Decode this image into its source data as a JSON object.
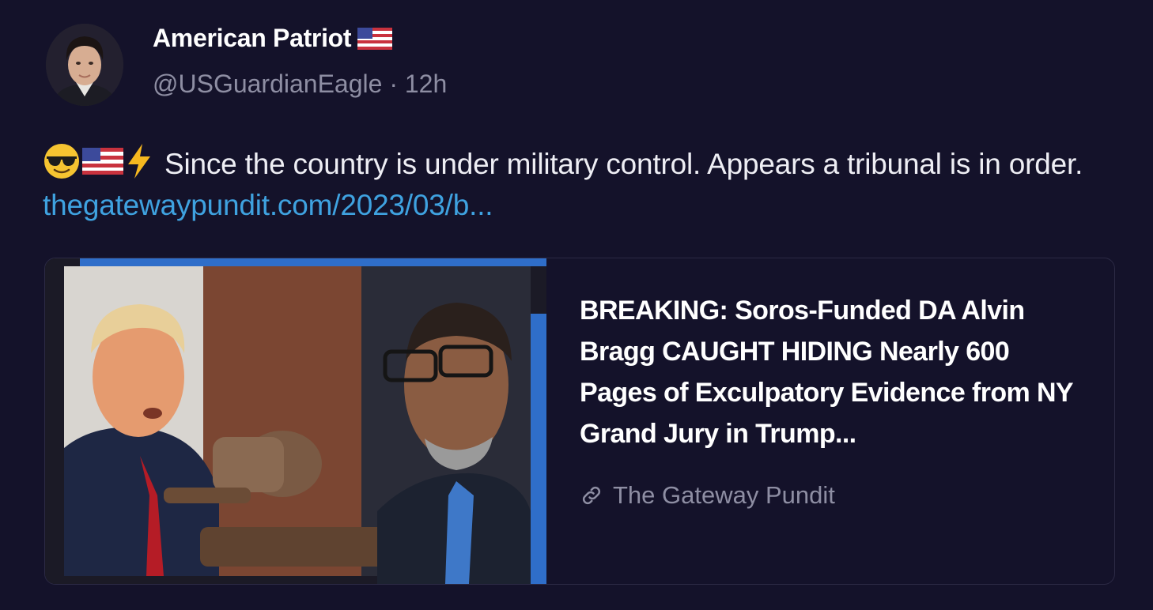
{
  "author": {
    "display_name": "American Patriot",
    "handle": "@USGuardianEagle",
    "separator": "·",
    "time_ago": "12h",
    "avatar_icon": "profile-photo-icon",
    "name_emoji": "us-flag-icon"
  },
  "post": {
    "emojis": [
      "sunglasses-face-icon",
      "us-flag-icon",
      "lightning-icon"
    ],
    "text": "Since the country is under military control. Appears a tribunal is in order.",
    "link_text": "thegatewaypundit.com/2023/03/b..."
  },
  "link_card": {
    "title": "BREAKING: Soros-Funded DA Alvin Bragg CAUGHT HIDING Nearly 600 Pages of Exculpatory Evidence from NY Grand Jury in Trump...",
    "source": "The Gateway Pundit",
    "source_icon": "link-icon",
    "image_icon": "article-thumbnail-image"
  },
  "colors": {
    "background": "#14122a",
    "link": "#3fa2e0",
    "muted": "#8e8ea3",
    "card_border": "#2c2a45",
    "image_accent": "#2f6ec9"
  }
}
